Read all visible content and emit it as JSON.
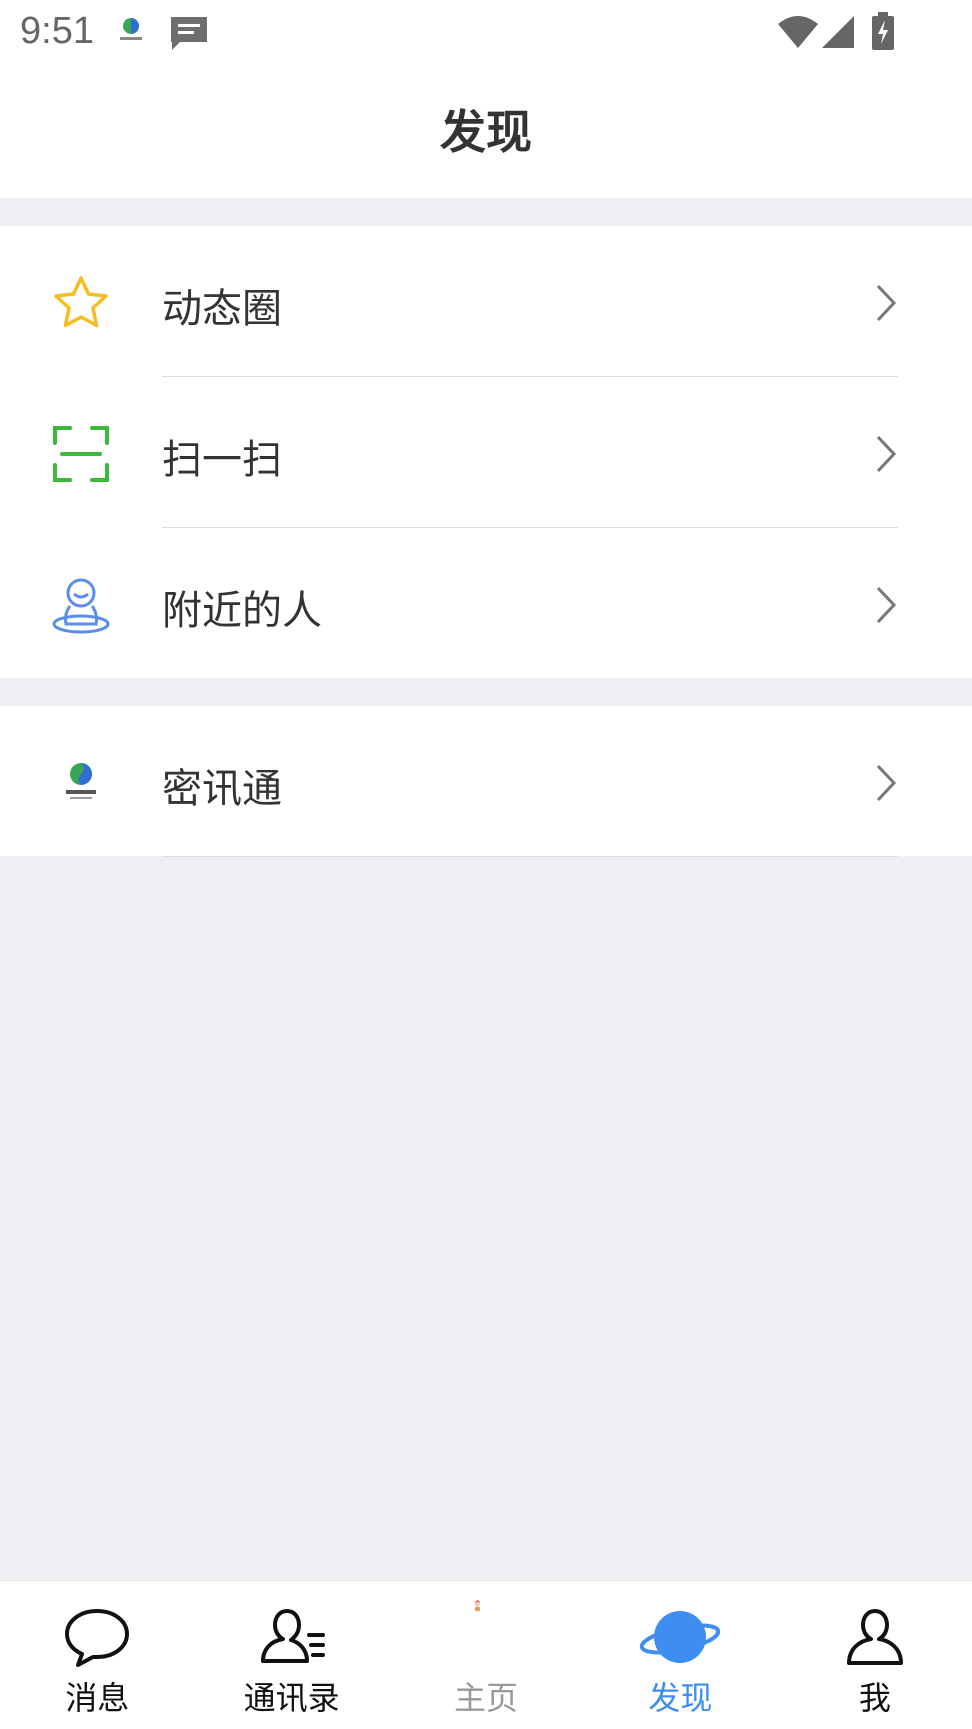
{
  "status_bar": {
    "time": "9:51",
    "icons": [
      "mixuntong-app-icon",
      "message-notification-icon",
      "wifi-icon",
      "cell-signal-icon",
      "battery-charging-icon"
    ]
  },
  "header": {
    "title": "发现"
  },
  "groups": [
    {
      "items": [
        {
          "label": "动态圈",
          "icon": "star-icon",
          "icon_color": "#f5bd1f"
        },
        {
          "label": "扫一扫",
          "icon": "scan-icon",
          "icon_color": "#3cb83c"
        },
        {
          "label": "附近的人",
          "icon": "nearby-person-icon",
          "icon_color": "#5b8def"
        }
      ]
    },
    {
      "items": [
        {
          "label": "密讯通",
          "icon": "mixuntong-logo-icon",
          "icon_color": "#2e8b57"
        }
      ]
    }
  ],
  "tab_bar": {
    "tabs": [
      {
        "label": "消息",
        "icon": "chat-bubble-icon",
        "active": false
      },
      {
        "label": "通讯录",
        "icon": "contacts-icon",
        "active": false
      },
      {
        "label": "主页",
        "icon": "home-avatar-icon",
        "active": false
      },
      {
        "label": "发现",
        "icon": "planet-icon",
        "active": true
      },
      {
        "label": "我",
        "icon": "person-icon",
        "active": false
      }
    ],
    "active_color": "#3d8ef0",
    "inactive_color": "#111111"
  }
}
